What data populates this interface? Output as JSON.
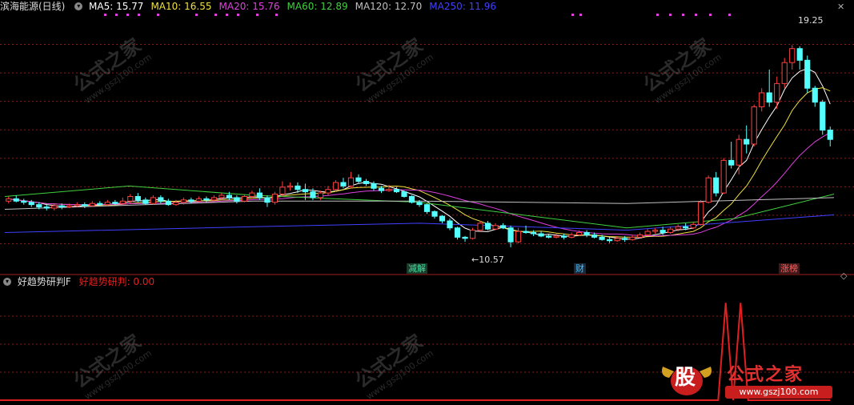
{
  "header": {
    "stock": "滨海能源(日线)",
    "ma": [
      {
        "label": "MA5: 15.77",
        "color": "#ffffff"
      },
      {
        "label": "MA10: 16.55",
        "color": "#f0e040"
      },
      {
        "label": "MA20: 15.76",
        "color": "#e040e0"
      },
      {
        "label": "MA60: 12.89",
        "color": "#40d040"
      },
      {
        "label": "MA120: 12.70",
        "color": "#c0c0c0"
      },
      {
        "label": "MA250: 11.96",
        "color": "#4040ff"
      }
    ]
  },
  "indicator": {
    "name": "好趋势研判F",
    "value_label": "好趋势研判: 0.00"
  },
  "annotations": {
    "high": "19.25",
    "low": "←10.57",
    "tags": [
      {
        "text": "减解",
        "color": "#40e0a0"
      },
      {
        "text": "财",
        "color": "#40c0ff"
      },
      {
        "text": "涨榜",
        "color": "#ff6060"
      }
    ]
  },
  "watermark": {
    "text": "公式之家",
    "url": "www.gszj100.com"
  },
  "logo": {
    "text": "公式之家",
    "url": "www.gszj100.com",
    "mark": "股"
  },
  "colors": {
    "up": "#ff4040",
    "down": "#54ffff",
    "bg": "#000000",
    "signal": "#e02020",
    "grid": "#8b1a1a"
  },
  "chart_data": [
    {
      "type": "candlestick",
      "title": "滨海能源(日线)",
      "ylim": [
        9.5,
        20.5
      ],
      "candles": [
        [
          12.55,
          12.65,
          12.75,
          12.45
        ],
        [
          12.65,
          12.55,
          12.8,
          12.5
        ],
        [
          12.55,
          12.5,
          12.65,
          12.4
        ],
        [
          12.5,
          12.4,
          12.6,
          12.3
        ],
        [
          12.4,
          12.3,
          12.5,
          12.2
        ],
        [
          12.3,
          12.25,
          12.4,
          12.15
        ],
        [
          12.25,
          12.35,
          12.45,
          12.15
        ],
        [
          12.35,
          12.3,
          12.45,
          12.2
        ],
        [
          12.3,
          12.35,
          12.45,
          12.25
        ],
        [
          12.35,
          12.4,
          12.5,
          12.3
        ],
        [
          12.4,
          12.35,
          12.5,
          12.25
        ],
        [
          12.35,
          12.45,
          12.55,
          12.3
        ],
        [
          12.45,
          12.4,
          12.55,
          12.35
        ],
        [
          12.4,
          12.5,
          12.6,
          12.35
        ],
        [
          12.5,
          12.45,
          12.6,
          12.35
        ],
        [
          12.45,
          12.55,
          12.7,
          12.4
        ],
        [
          12.55,
          12.75,
          12.85,
          12.45
        ],
        [
          12.75,
          12.6,
          12.9,
          12.5
        ],
        [
          12.6,
          12.45,
          12.7,
          12.4
        ],
        [
          12.45,
          12.7,
          12.8,
          12.4
        ],
        [
          12.7,
          12.55,
          12.8,
          12.45
        ],
        [
          12.55,
          12.4,
          12.65,
          12.35
        ],
        [
          12.4,
          12.5,
          12.6,
          12.35
        ],
        [
          12.5,
          12.6,
          12.7,
          12.4
        ],
        [
          12.6,
          12.55,
          12.7,
          12.45
        ],
        [
          12.55,
          12.65,
          12.75,
          12.5
        ],
        [
          12.65,
          12.6,
          12.75,
          12.5
        ],
        [
          12.6,
          12.7,
          12.8,
          12.55
        ],
        [
          12.7,
          12.8,
          12.9,
          12.6
        ],
        [
          12.8,
          12.7,
          12.95,
          12.6
        ],
        [
          12.7,
          12.55,
          12.8,
          12.45
        ],
        [
          12.55,
          12.75,
          12.85,
          12.5
        ],
        [
          12.75,
          12.9,
          13.0,
          12.65
        ],
        [
          12.9,
          12.7,
          13.1,
          12.6
        ],
        [
          12.7,
          12.5,
          12.8,
          12.3
        ],
        [
          12.5,
          12.85,
          12.95,
          12.4
        ],
        [
          12.85,
          13.15,
          13.4,
          12.75
        ],
        [
          13.15,
          13.2,
          13.35,
          13.0
        ],
        [
          13.2,
          13.05,
          13.35,
          12.9
        ],
        [
          13.05,
          12.95,
          13.3,
          12.6
        ],
        [
          12.95,
          12.7,
          13.1,
          12.6
        ],
        [
          12.7,
          12.9,
          13.0,
          12.6
        ],
        [
          12.9,
          13.05,
          13.2,
          12.8
        ],
        [
          13.05,
          13.35,
          13.45,
          12.95
        ],
        [
          13.35,
          13.2,
          13.55,
          13.1
        ],
        [
          13.2,
          13.55,
          13.8,
          13.1
        ],
        [
          13.55,
          13.4,
          13.7,
          13.3
        ],
        [
          13.4,
          13.3,
          13.5,
          13.2
        ],
        [
          13.3,
          13.1,
          13.4,
          13.0
        ],
        [
          13.1,
          13.0,
          13.2,
          12.9
        ],
        [
          13.0,
          13.05,
          13.25,
          12.95
        ],
        [
          13.05,
          12.95,
          13.15,
          12.9
        ],
        [
          12.95,
          12.75,
          13.0,
          12.7
        ],
        [
          12.75,
          12.5,
          12.8,
          12.45
        ],
        [
          12.5,
          12.4,
          12.6,
          12.3
        ],
        [
          12.4,
          12.1,
          12.45,
          12.0
        ],
        [
          12.1,
          11.9,
          12.15,
          11.8
        ],
        [
          11.9,
          11.7,
          11.95,
          11.6
        ],
        [
          11.7,
          11.4,
          11.8,
          11.3
        ],
        [
          11.4,
          11.0,
          11.45,
          10.9
        ],
        [
          11.0,
          10.95,
          11.05,
          10.8
        ],
        [
          10.95,
          11.3,
          11.4,
          10.9
        ],
        [
          11.3,
          11.6,
          11.7,
          11.25
        ],
        [
          11.6,
          11.35,
          11.7,
          11.3
        ],
        [
          11.35,
          11.5,
          11.6,
          11.3
        ],
        [
          11.5,
          11.4,
          11.6,
          11.35
        ],
        [
          11.4,
          10.8,
          11.5,
          10.57
        ],
        [
          10.8,
          11.25,
          11.4,
          10.75
        ],
        [
          11.25,
          11.2,
          11.5,
          11.15
        ],
        [
          11.2,
          11.15,
          11.3,
          11.05
        ],
        [
          11.15,
          11.05,
          11.25,
          11.0
        ],
        [
          11.05,
          11.0,
          11.15,
          10.95
        ],
        [
          11.0,
          11.05,
          11.15,
          10.95
        ],
        [
          11.05,
          11.0,
          11.15,
          10.9
        ],
        [
          11.0,
          11.1,
          11.2,
          10.95
        ],
        [
          11.1,
          11.2,
          11.3,
          11.05
        ],
        [
          11.2,
          11.1,
          11.3,
          11.0
        ],
        [
          11.1,
          11.0,
          11.2,
          10.95
        ],
        [
          11.0,
          10.9,
          11.1,
          10.85
        ],
        [
          10.9,
          10.85,
          11.0,
          10.75
        ],
        [
          10.85,
          10.95,
          11.05,
          10.8
        ],
        [
          10.95,
          10.9,
          11.05,
          10.8
        ],
        [
          10.9,
          11.0,
          11.1,
          10.85
        ],
        [
          11.0,
          11.1,
          11.2,
          10.95
        ],
        [
          11.1,
          11.25,
          11.35,
          11.05
        ],
        [
          11.25,
          11.3,
          11.4,
          11.15
        ],
        [
          11.3,
          11.2,
          11.45,
          11.1
        ],
        [
          11.2,
          11.35,
          11.45,
          11.15
        ],
        [
          11.35,
          11.45,
          11.55,
          11.25
        ],
        [
          11.45,
          11.4,
          11.6,
          11.3
        ],
        [
          11.4,
          11.55,
          11.65,
          11.35
        ],
        [
          11.55,
          12.5,
          12.6,
          11.5
        ],
        [
          12.5,
          13.55,
          13.65,
          12.45
        ],
        [
          13.55,
          12.9,
          13.8,
          12.75
        ],
        [
          12.9,
          14.3,
          14.4,
          12.85
        ],
        [
          14.3,
          14.1,
          15.1,
          13.95
        ],
        [
          14.1,
          15.2,
          15.4,
          13.7
        ],
        [
          15.2,
          15.0,
          15.8,
          14.6
        ],
        [
          15.0,
          16.6,
          16.7,
          14.9
        ],
        [
          16.6,
          17.2,
          17.4,
          16.4
        ],
        [
          17.2,
          16.8,
          18.2,
          16.6
        ],
        [
          16.8,
          17.6,
          17.9,
          16.5
        ],
        [
          17.6,
          18.5,
          18.7,
          17.4
        ],
        [
          18.5,
          19.1,
          19.25,
          18.2
        ],
        [
          19.1,
          18.6,
          19.2,
          18.2
        ],
        [
          18.6,
          17.4,
          18.8,
          17.2
        ],
        [
          17.4,
          16.8,
          17.5,
          16.6
        ],
        [
          16.8,
          15.6,
          16.9,
          15.4
        ],
        [
          15.6,
          15.2,
          15.75,
          14.9
        ]
      ]
    },
    {
      "type": "line",
      "title": "好趋势研判F",
      "ylim": [
        0,
        1.15
      ],
      "series": [
        {
          "name": "好趋势研判",
          "color": "#e02020",
          "values": [
            0,
            0,
            0,
            0,
            0,
            0,
            0,
            0,
            0,
            0,
            0,
            0,
            0,
            0,
            0,
            0,
            0,
            0,
            0,
            0,
            0,
            0,
            0,
            0,
            0,
            0,
            0,
            0,
            0,
            0,
            0,
            0,
            0,
            0,
            0,
            0,
            0,
            0,
            0,
            0,
            0,
            0,
            0,
            0,
            0,
            0,
            0,
            0,
            0,
            0,
            0,
            0,
            0,
            0,
            0,
            0,
            0,
            0,
            0,
            0,
            0,
            0,
            0,
            0,
            0,
            0,
            0,
            0,
            0,
            0,
            0,
            0,
            0,
            0,
            0,
            0,
            0,
            0,
            0,
            0,
            0,
            0,
            0,
            0,
            0,
            0,
            0,
            0,
            0,
            0,
            0,
            0,
            0,
            0,
            0,
            0,
            1,
            0,
            1,
            0,
            0,
            0,
            0,
            0,
            0,
            0,
            0,
            0,
            0,
            0,
            0
          ]
        }
      ]
    }
  ]
}
